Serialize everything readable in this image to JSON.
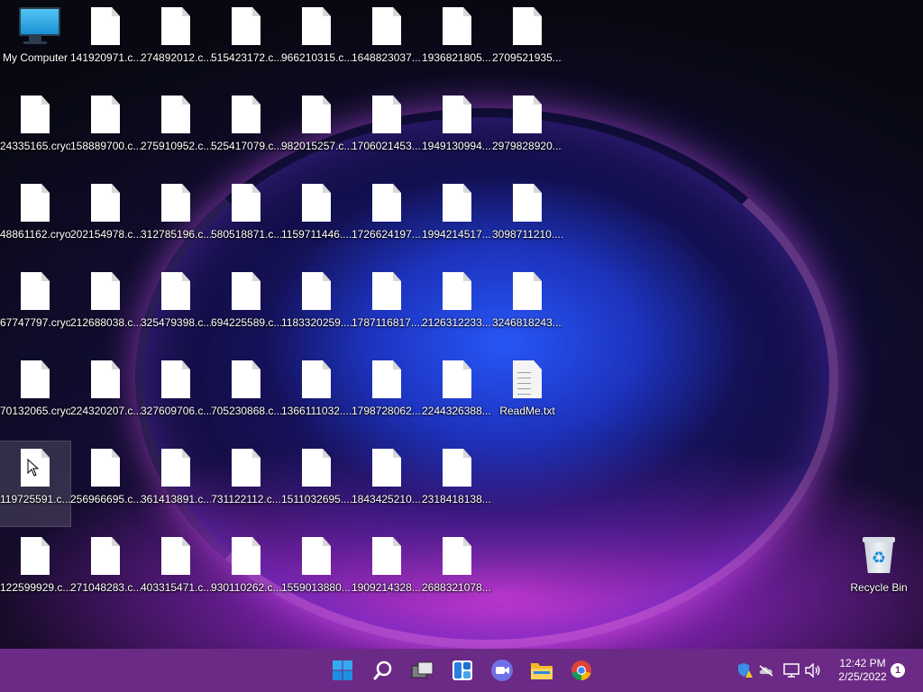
{
  "desktop": {
    "my_computer": "My Computer",
    "recycle_bin": "Recycle Bin",
    "files": [
      [
        "141920971.c...",
        "274892012.c...",
        "515423172.c...",
        "966210315.c...",
        "1648823037....",
        "1936821805....",
        "2709521935...."
      ],
      [
        "24335165.cryo",
        "158889700.c...",
        "275910952.c...",
        "525417079.c...",
        "982015257.c...",
        "1706021453....",
        "1949130994....",
        "2979828920...."
      ],
      [
        "48861162.cryo",
        "202154978.c...",
        "312785196.c...",
        "580518871.c...",
        "1159711446....",
        "1726624197....",
        "1994214517....",
        "3098711210...."
      ],
      [
        "67747797.cryo",
        "212688038.c...",
        "325479398.c...",
        "694225589.c...",
        "1183320259....",
        "1787116817....",
        "2126312233....",
        "3246818243...."
      ],
      [
        "70132065.cryo",
        "224320207.c...",
        "327609706.c...",
        "705230868.c...",
        "1366111032....",
        "1798728062....",
        "2244326388....",
        "ReadMe.txt"
      ],
      [
        "119725591.c...",
        "256966695.c...",
        "361413891.c...",
        "731122112.c...",
        "1511032695....",
        "1843425210....",
        "2318418138...."
      ],
      [
        "122599929.c...",
        "271048283.c...",
        "403315471.c...",
        "930110262.c...",
        "1559013880....",
        "1909214328....",
        "2688321078...."
      ]
    ]
  },
  "taskbar": {
    "time": "12:42 PM",
    "date": "2/25/2022",
    "notification_count": "1",
    "accent": "#6b2a85"
  },
  "icons": [
    "windows-start-icon",
    "search-icon",
    "task-view-icon",
    "widgets-icon",
    "chat-icon",
    "file-explorer-icon",
    "chrome-icon",
    "defender-warning-icon",
    "onedrive-icon",
    "network-icon",
    "volume-icon"
  ]
}
